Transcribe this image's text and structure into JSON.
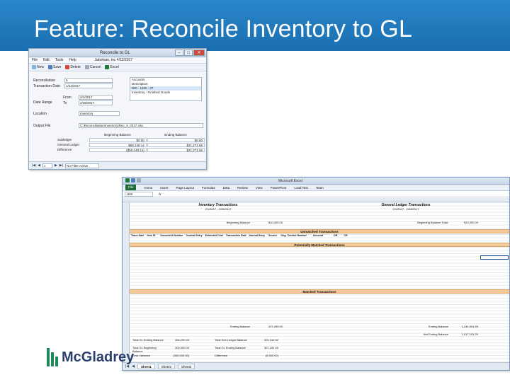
{
  "slide": {
    "title": "Feature: Reconcile Inventory to GL"
  },
  "dialog": {
    "title": "Reconcile to GL",
    "menu": [
      "File",
      "Edit",
      "Tools",
      "Help"
    ],
    "company": "Jabokam, Inc  4/12/2017",
    "toolbar": {
      "new": "New",
      "save": "Save",
      "delete": "Delete",
      "cancel": "Cancel",
      "excel": "Excel"
    },
    "labels": {
      "reconciliation": "Reconciliation",
      "transaction_date": "Transaction Date",
      "from": "From",
      "to": "To",
      "date_range": "Date Range",
      "location": "Location",
      "output_file": "Output File"
    },
    "values": {
      "reconciliation": "5",
      "transaction_date": "1/12/2017",
      "from": "2/1/2017",
      "to": "2/28/2017",
      "location": "Inventory",
      "output_file": "C:\\Reconciliation\\Inventory\\Rec_5_0317.xlsx"
    },
    "lookup": [
      "Accounts",
      "Description",
      "000 - 1330 - 07",
      "Inventory - Finished Goods"
    ],
    "balances": {
      "headers": [
        "",
        "Beginning Balance",
        "Ending Balance"
      ],
      "rows": [
        {
          "label": "Subledger",
          "begin": "$0.00",
          "end": "$0.00"
        },
        {
          "label": "General Ledger",
          "begin": "$58,148.14",
          "end": "$21,271.56"
        },
        {
          "label": "Difference",
          "begin": "($58,148.14)",
          "end": "$21,271.56"
        }
      ]
    },
    "nav": {
      "record": "1",
      "search": "No Filter Active"
    }
  },
  "excel": {
    "title": "Microsoft Excel",
    "ribbon": [
      "File",
      "Home",
      "Insert",
      "Page Layout",
      "Formulas",
      "Data",
      "Review",
      "View",
      "PowerPivot",
      "Load Test",
      "Team"
    ],
    "name_box": "U62",
    "fx": "fx",
    "sections": {
      "inventory": "Inventory Transactions",
      "gl": "General Ledger Transactions",
      "inv_dates": "2/1/2017 - 2/28/2017",
      "gl_dates": "2/1/2017 - 2/28/2017",
      "begin_balance_label": "Beginning Balance",
      "begin_balance_value": "$10,000.00",
      "gl_begin_label": "Beginning Balance Total:",
      "gl_begin_value": "$10,000.00",
      "unmatched": "Unmatched Transactions",
      "potentially": "Potentially Matched Transactions",
      "matched": "Matched Transactions",
      "ending_balance_label": "Ending Balance",
      "ending_balance_value": "227,259.00",
      "gl_ending_label": "Ending Balance",
      "gl_ending_value": "1,244,591.59",
      "net_ending_label": "Net Ending Balance",
      "net_ending_value": "1,017,151.20"
    },
    "col_headers": [
      "Trans Date",
      "Item ID",
      "Document Number",
      "Journal Entry",
      "Extended Cost",
      "Transaction Date",
      "Journal Entry",
      "Source",
      "Orig. Control Number",
      "Account",
      "DR",
      "CR"
    ],
    "totals": {
      "left": [
        {
          "label": "Total GL Ending Balance",
          "value": "454,290.49"
        },
        {
          "label": "Total GL Beginning Balance",
          "value": "300,000.00"
        },
        {
          "label": "Less Variance",
          "value": "(300,000.00)"
        }
      ],
      "right": [
        {
          "label": "Total Sub Ledger Balance",
          "value": "301,242.02"
        },
        {
          "label": "Total GL Ending Balance",
          "value": "307,151.00"
        },
        {
          "label": "Difference",
          "value": "(5,909.00)"
        }
      ]
    },
    "sheets": [
      "Sheet1",
      "Sheet2",
      "Sheet3"
    ]
  },
  "logo": {
    "text": "McGladrey"
  }
}
